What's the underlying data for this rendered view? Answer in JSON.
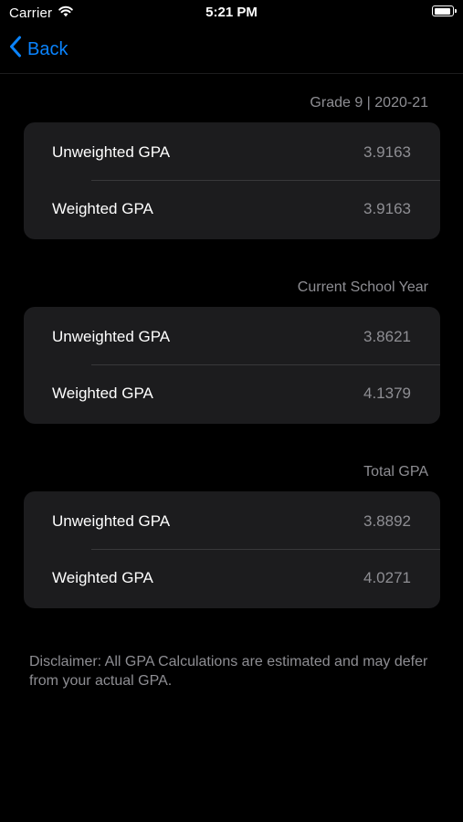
{
  "status_bar": {
    "carrier": "Carrier",
    "time": "5:21 PM",
    "icons": [
      "wifi-icon",
      "battery-icon"
    ],
    "battery_level": 0.9
  },
  "nav": {
    "back_label": "Back",
    "back_icon": "chevron-left-icon"
  },
  "colors": {
    "accent": "#0a84ff",
    "background": "#000000",
    "card": "#1c1c1e",
    "secondary_text": "#8e8e93",
    "separator": "#38383a"
  },
  "sections": [
    {
      "header": "Grade 9 | 2020-21",
      "rows": [
        {
          "label": "Unweighted GPA",
          "value": "3.9163"
        },
        {
          "label": "Weighted GPA",
          "value": "3.9163"
        }
      ]
    },
    {
      "header": "Current School Year",
      "rows": [
        {
          "label": "Unweighted GPA",
          "value": "3.8621"
        },
        {
          "label": "Weighted GPA",
          "value": "4.1379"
        }
      ]
    },
    {
      "header": "Total GPA",
      "rows": [
        {
          "label": "Unweighted GPA",
          "value": "3.8892"
        },
        {
          "label": "Weighted GPA",
          "value": "4.0271"
        }
      ]
    }
  ],
  "disclaimer": "Disclaimer: All GPA Calculations are estimated and may defer from your actual GPA."
}
